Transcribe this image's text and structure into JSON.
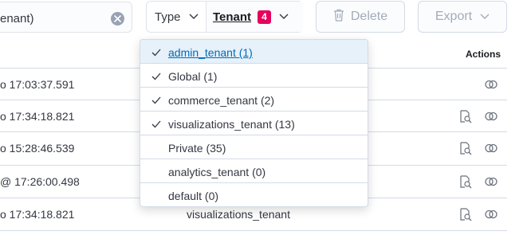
{
  "search": {
    "value": "enant)"
  },
  "filters": {
    "type_label": "Type",
    "tenant_label": "Tenant",
    "tenant_count": "4"
  },
  "toolbar": {
    "delete_label": "Delete",
    "export_label": "Export"
  },
  "table": {
    "actions_header": "Actions",
    "rows": [
      {
        "date": "o 17:03:37.591",
        "tenant": ""
      },
      {
        "date": "o 17:34:18.821",
        "tenant": ""
      },
      {
        "date": "o 15:28:46.539",
        "tenant": ""
      },
      {
        "date": "@ 17:26:00.498",
        "tenant": ""
      },
      {
        "date": "o 17:34:18.821",
        "tenant": "visualizations_tenant"
      }
    ]
  },
  "tenant_dropdown": {
    "options": [
      {
        "label": "admin_tenant (1)",
        "checked": true
      },
      {
        "label": "Global (1)",
        "checked": true
      },
      {
        "label": "commerce_tenant (2)",
        "checked": true
      },
      {
        "label": "visualizations_tenant (13)",
        "checked": true
      },
      {
        "label": "Private (35)",
        "checked": false
      },
      {
        "label": "analytics_tenant (0)",
        "checked": false
      },
      {
        "label": "default (0)",
        "checked": false
      }
    ]
  },
  "colors": {
    "accent": "#006bb8",
    "badge": "#e7005c",
    "border": "#d3dae6",
    "icon": "#69707d"
  }
}
